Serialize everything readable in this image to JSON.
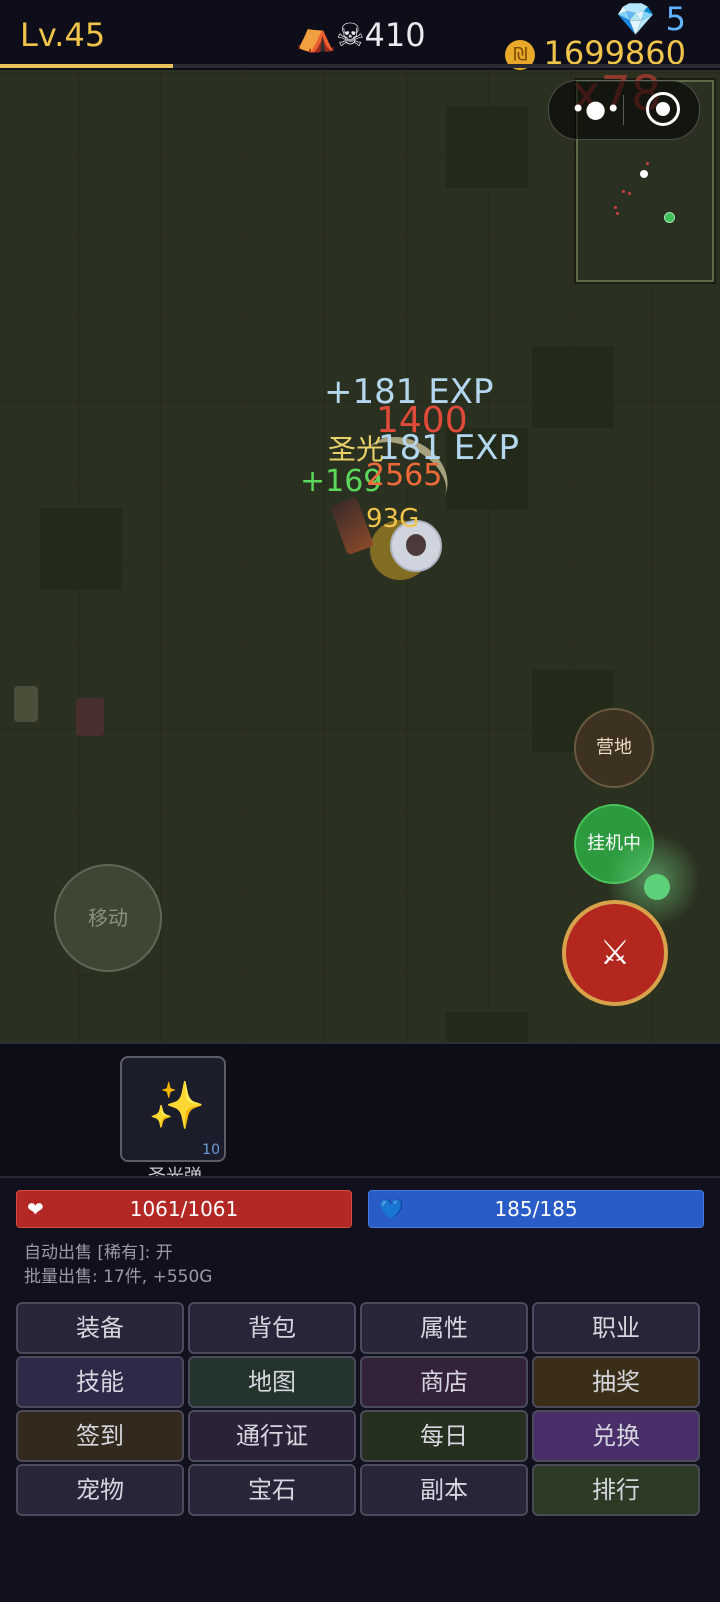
{
  "header": {
    "level": "Lv.45",
    "level_progress": 0.24,
    "kills_icon": "camp-and-skull-icon",
    "kills": "410",
    "gems": "5",
    "gold": "1699860"
  },
  "overlay": {
    "combo": "x78"
  },
  "combat_text": {
    "exp_a": "+181 EXP",
    "damage_a": "1400",
    "skill_name": "圣光",
    "exp_b": "181 EXP",
    "heal": "+169",
    "damage_b": "2565",
    "gold_drop": "93G"
  },
  "controls": {
    "camp": "营地",
    "idle": "挂机中",
    "attack_icon": "crossed-swords-icon",
    "move": "移动"
  },
  "skill": {
    "icon": "sparkles-icon",
    "count": "10",
    "name": "圣光弹"
  },
  "stats": {
    "hp": "1061/1061",
    "mp": "185/185",
    "auto_sell": "自动出售 [稀有]: 开",
    "batch_sell": "批量出售: 17件, +550G"
  },
  "menu": [
    {
      "label": "装备",
      "color": "#2a2438"
    },
    {
      "label": "背包",
      "color": "#2a2438"
    },
    {
      "label": "属性",
      "color": "#2a2438"
    },
    {
      "label": "职业",
      "color": "#2a2438"
    },
    {
      "label": "技能",
      "color": "#2c2a48"
    },
    {
      "label": "地图",
      "color": "#22342c"
    },
    {
      "label": "商店",
      "color": "#34223a"
    },
    {
      "label": "抽奖",
      "color": "#3a2e18"
    },
    {
      "label": "签到",
      "color": "#33291c"
    },
    {
      "label": "通行证",
      "color": "#2c2238"
    },
    {
      "label": "每日",
      "color": "#26301e"
    },
    {
      "label": "兑换",
      "color": "#4a2e6a"
    },
    {
      "label": "宠物",
      "color": "#2a2438"
    },
    {
      "label": "宝石",
      "color": "#2a2438"
    },
    {
      "label": "副本",
      "color": "#2a2438"
    },
    {
      "label": "排行",
      "color": "#2c3a26"
    }
  ]
}
